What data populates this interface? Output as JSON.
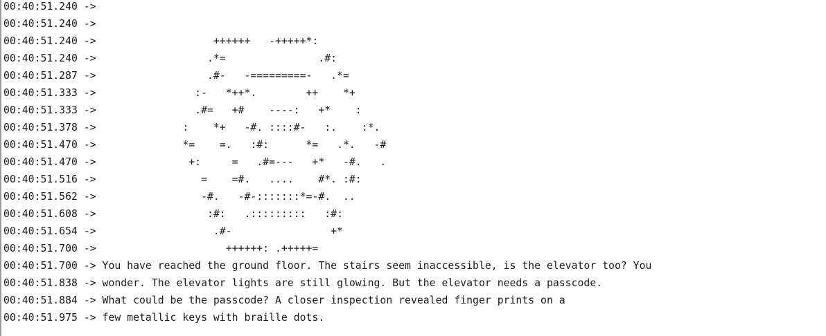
{
  "serial_log": {
    "lines": [
      {
        "timestamp": "00:40:51.240",
        "arrow": " -> ",
        "text": ""
      },
      {
        "timestamp": "00:40:51.240",
        "arrow": " -> ",
        "text": ""
      },
      {
        "timestamp": "00:40:51.240",
        "arrow": " -> ",
        "text": "                  ++++++   -+++++*:"
      },
      {
        "timestamp": "00:40:51.240",
        "arrow": " -> ",
        "text": "                 .*=               .#:"
      },
      {
        "timestamp": "00:40:51.287",
        "arrow": " -> ",
        "text": "                 .#-   -=========-   .*="
      },
      {
        "timestamp": "00:40:51.333",
        "arrow": " -> ",
        "text": "               :-   *++*.        ++    *+"
      },
      {
        "timestamp": "00:40:51.333",
        "arrow": " -> ",
        "text": "               .#=   +#    ----:   +*    :"
      },
      {
        "timestamp": "00:40:51.378",
        "arrow": " -> ",
        "text": "             :    *+   -#. ::::#-   :.    :*."
      },
      {
        "timestamp": "00:40:51.470",
        "arrow": " -> ",
        "text": "             *=    =.   :#:      *=   .*.   -#"
      },
      {
        "timestamp": "00:40:51.470",
        "arrow": " -> ",
        "text": "              +:     =   .#=---   +*   -#.   ."
      },
      {
        "timestamp": "00:40:51.516",
        "arrow": " -> ",
        "text": "                =    =#.   ....    #*. :#:"
      },
      {
        "timestamp": "00:40:51.562",
        "arrow": " -> ",
        "text": "                -#.   -#-:::::::*=-#.  .."
      },
      {
        "timestamp": "00:40:51.608",
        "arrow": " -> ",
        "text": "                 :#:   .:::::::::   :#:"
      },
      {
        "timestamp": "00:40:51.654",
        "arrow": " -> ",
        "text": "                  .#-                +*"
      },
      {
        "timestamp": "00:40:51.700",
        "arrow": " -> ",
        "text": "                    ++++++: .+++++="
      },
      {
        "timestamp": "00:40:51.700",
        "arrow": " -> ",
        "text": "You have reached the ground floor. The stairs seem inaccessible, is the elevator too? You"
      },
      {
        "timestamp": "00:40:51.838",
        "arrow": " -> ",
        "text": "wonder. The elevator lights are still glowing. But the elevator needs a passcode."
      },
      {
        "timestamp": "00:40:51.884",
        "arrow": " -> ",
        "text": "What could be the passcode? A closer inspection revealed finger prints on a"
      },
      {
        "timestamp": "00:40:51.975",
        "arrow": " -> ",
        "text": "few metallic keys with braille dots."
      }
    ]
  }
}
